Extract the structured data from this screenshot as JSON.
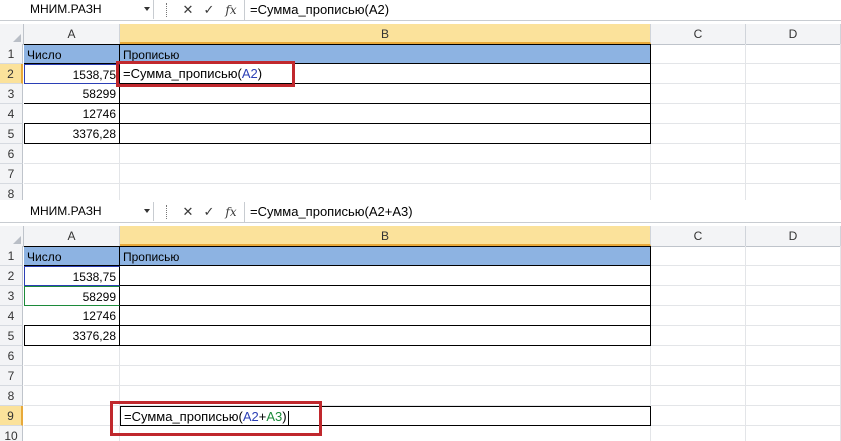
{
  "panes": [
    {
      "name_box": "МНИМ.РАЗН",
      "formula": "=Сумма_прописью(A2)",
      "columns": [
        "A",
        "B",
        "C",
        "D"
      ],
      "rows": [
        "1",
        "2",
        "3",
        "4",
        "5",
        "6",
        "7",
        "8"
      ],
      "table": {
        "header_a": "Число",
        "header_b": "Прописью",
        "values": [
          "1538,75",
          "58299",
          "12746",
          "3376,28"
        ]
      },
      "edit_cell": {
        "prefix": "=Сумма_прописью(",
        "ref1": "A2",
        "suffix": ")"
      }
    },
    {
      "name_box": "МНИМ.РАЗН",
      "formula": "=Сумма_прописью(A2+A3)",
      "columns": [
        "A",
        "B",
        "C",
        "D"
      ],
      "rows": [
        "1",
        "2",
        "3",
        "4",
        "5",
        "6",
        "7",
        "8",
        "9",
        "10"
      ],
      "table": {
        "header_a": "Число",
        "header_b": "Прописью",
        "values": [
          "1538,75",
          "58299",
          "12746",
          "3376,28"
        ]
      },
      "edit_cell": {
        "prefix": "=Сумма_прописью(",
        "ref1": "A2",
        "plus": "+",
        "ref2": "A3",
        "suffix": ")"
      }
    }
  ],
  "icons": {
    "cancel": "✕",
    "enter": "✓",
    "function": "fx"
  },
  "colors": {
    "header_fill": "#8db3e2",
    "selected_header": "#fbe29b",
    "highlight_box": "#c0282d",
    "ref_blue": "#2b3fb5",
    "ref_green": "#1c8a3a"
  }
}
